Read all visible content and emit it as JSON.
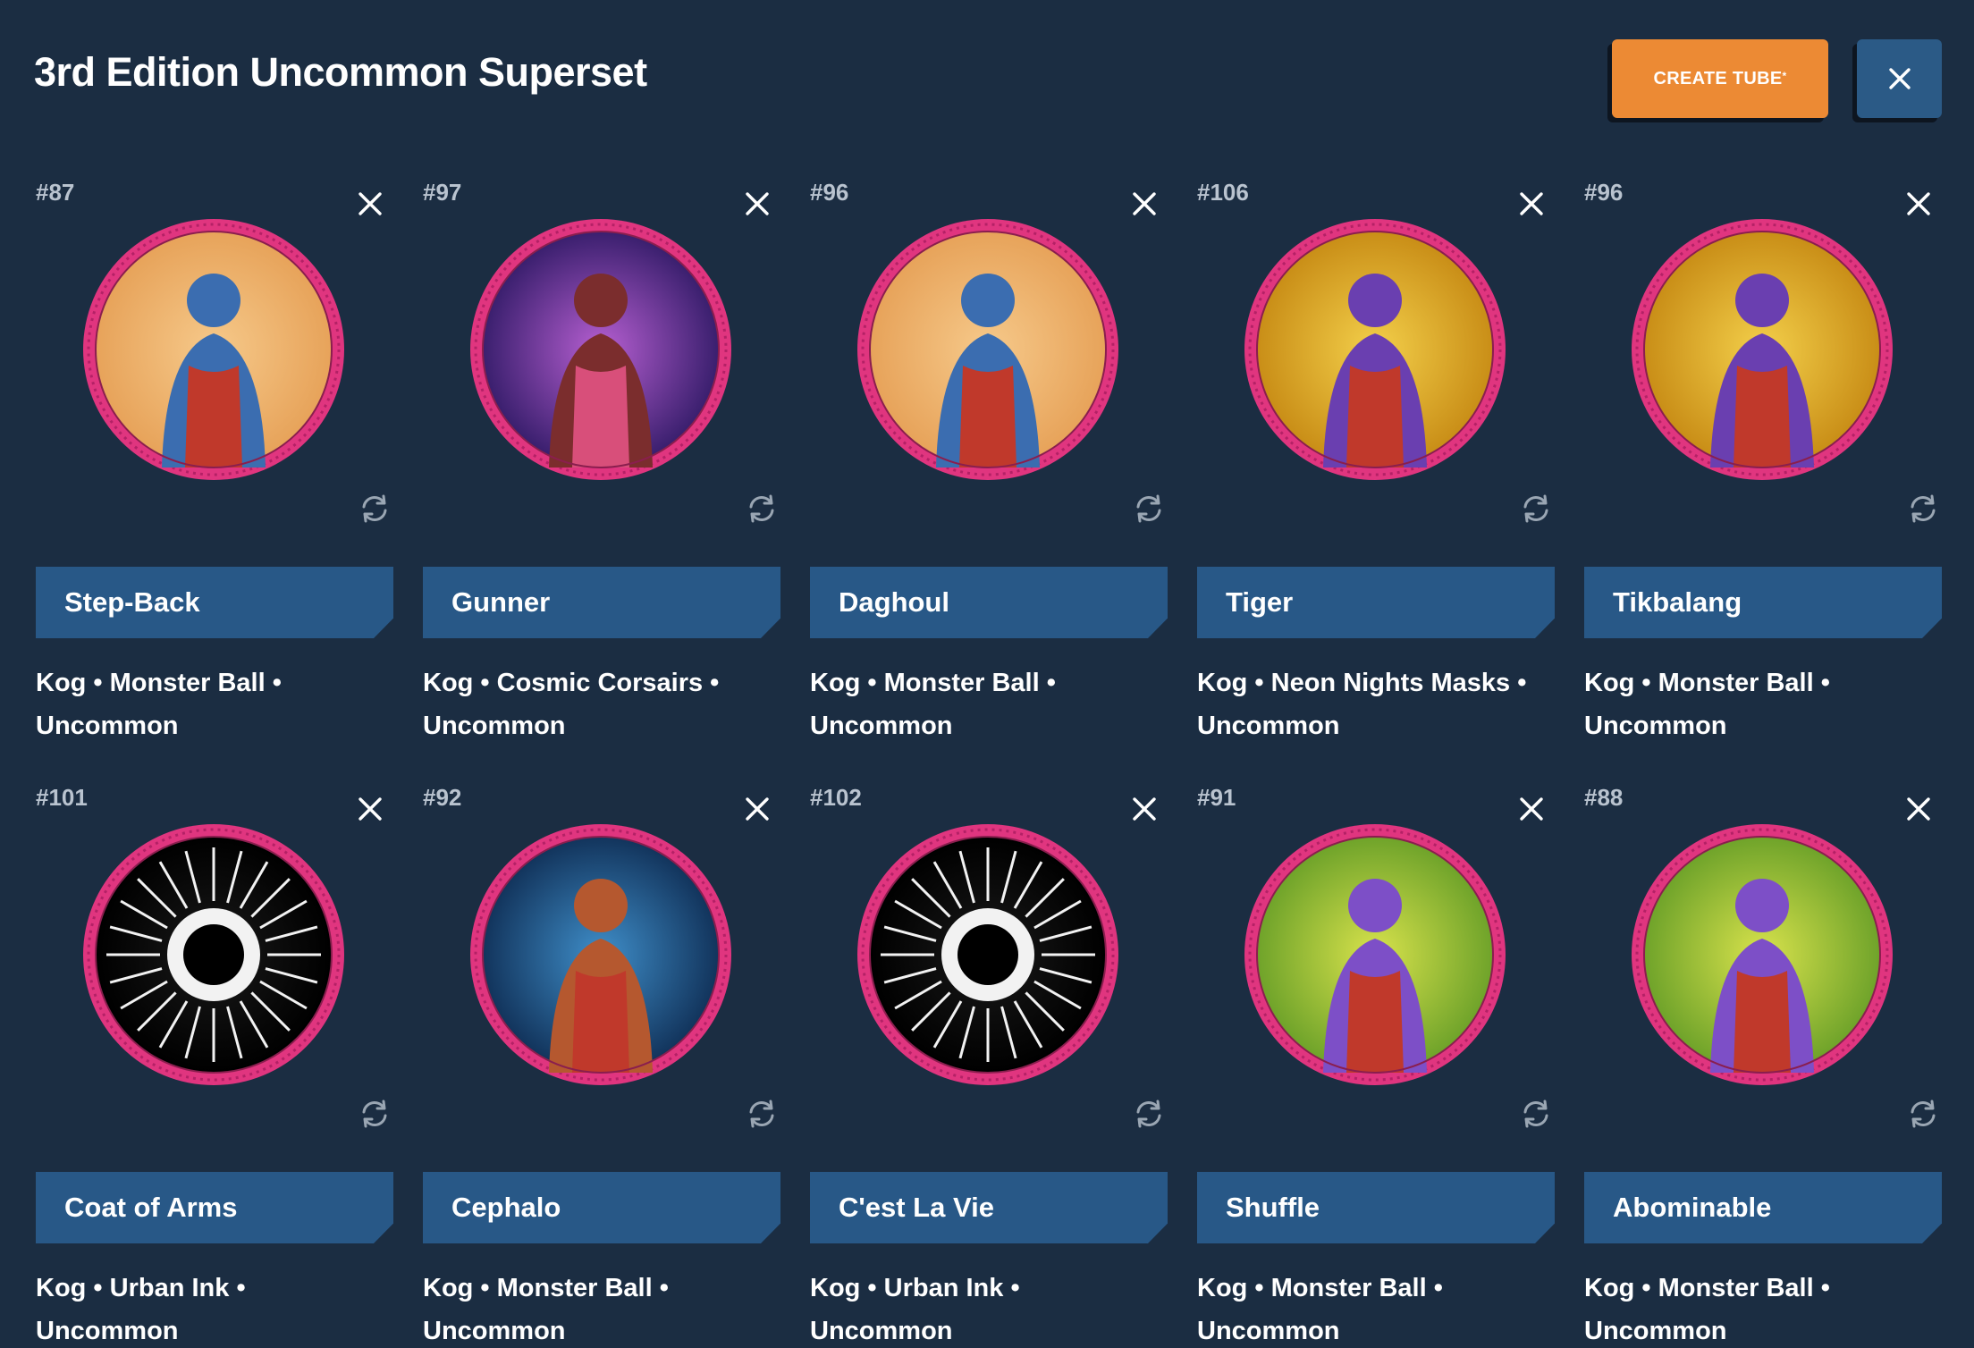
{
  "header": {
    "title": "3rd Edition Uncommon Superset",
    "create_label": "CREATE TUBE",
    "create_mark": "*",
    "close_icon": "close-icon"
  },
  "colors": {
    "background": "#1b2d42",
    "accent": "#ec8a34",
    "panel": "#285887",
    "token_rim": "#e0357f"
  },
  "cards": [
    {
      "number": "#87",
      "name": "Step-Back",
      "meta": "Kog • Monster Ball • Uncommon",
      "art": "peach"
    },
    {
      "number": "#97",
      "name": "Gunner",
      "meta": "Kog • Cosmic Corsairs • Uncommon",
      "art": "purple"
    },
    {
      "number": "#96",
      "name": "Daghoul",
      "meta": "Kog • Monster Ball • Uncommon",
      "art": "peach"
    },
    {
      "number": "#106",
      "name": "Tiger",
      "meta": "Kog • Neon Nights Masks • Uncommon",
      "art": "gold"
    },
    {
      "number": "#96",
      "name": "Tikbalang",
      "meta": "Kog • Monster Ball • Uncommon",
      "art": "gold"
    },
    {
      "number": "#101",
      "name": "Coat of Arms",
      "meta": "Kog • Urban Ink • Uncommon",
      "art": "mono"
    },
    {
      "number": "#92",
      "name": "Cephalo",
      "meta": "Kog • Monster Ball • Uncommon",
      "art": "blue"
    },
    {
      "number": "#102",
      "name": "C'est La Vie",
      "meta": "Kog • Urban Ink • Uncommon",
      "art": "mono"
    },
    {
      "number": "#91",
      "name": "Shuffle",
      "meta": "Kog • Monster Ball • Uncommon",
      "art": "green"
    },
    {
      "number": "#88",
      "name": "Abominable",
      "meta": "Kog • Monster Ball • Uncommon",
      "art": "green"
    }
  ]
}
